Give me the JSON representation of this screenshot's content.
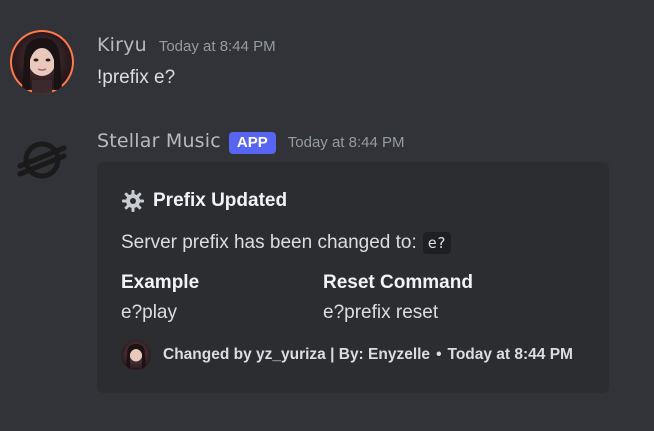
{
  "messages": [
    {
      "username": "Kiryu",
      "timestamp": "Today at 8:44 PM",
      "content": "!prefix e?"
    },
    {
      "username": "Stellar Music",
      "badge": "APP",
      "timestamp": "Today at 8:44 PM"
    }
  ],
  "embed": {
    "title": "Prefix Updated",
    "title_icon": "gear-icon",
    "description": "Server prefix has been changed to:",
    "prefix_code": "e?",
    "fields": [
      {
        "name": "Example",
        "value": "e?play"
      },
      {
        "name": "Reset Command",
        "value": "e?prefix reset"
      }
    ],
    "footer": {
      "text": "Changed by yz_yuriza | By: Enyzelle",
      "separator": "•",
      "timestamp": "Today at 8:44 PM"
    }
  },
  "colors": {
    "background": "#313338",
    "embed_background": "#2b2d31",
    "badge": "#5865f2",
    "avatar_ring": "#ff7a4a"
  }
}
